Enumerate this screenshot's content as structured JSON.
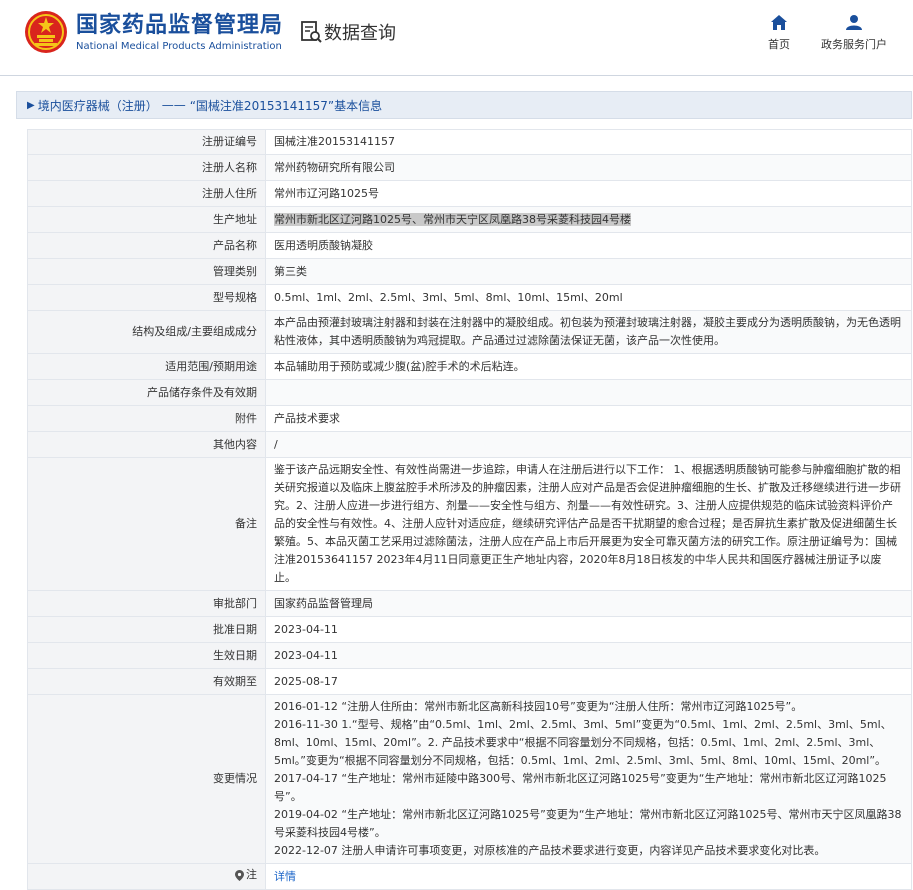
{
  "header": {
    "brand_cn": "国家药品监督管理局",
    "brand_en": "National Medical Products Administration",
    "query_label": "数据查询",
    "nav": {
      "home_label": "首页",
      "portal_label": "政务服务门户"
    }
  },
  "title_bar": {
    "part1": "境内医疗器械（注册）",
    "part2": "——",
    "part3": "“国械注准20153141157”基本信息"
  },
  "rows": {
    "reg_no": {
      "label": "注册证编号",
      "value": "国械注准20153141157"
    },
    "registrant": {
      "label": "注册人名称",
      "value": "常州药物研究所有限公司"
    },
    "registrant_addr": {
      "label": "注册人住所",
      "value": "常州市辽河路1025号"
    },
    "prod_addr": {
      "label": "生产地址",
      "value": "常州市新北区辽河路1025号、常州市天宁区凤凰路38号采菱科技园4号楼"
    },
    "product_name": {
      "label": "产品名称",
      "value": "医用透明质酸钠凝胶"
    },
    "category": {
      "label": "管理类别",
      "value": "第三类"
    },
    "model": {
      "label": "型号规格",
      "value": "0.5ml、1ml、2ml、2.5ml、3ml、5ml、8ml、10ml、15ml、20ml"
    },
    "structure": {
      "label": "结构及组成/主要组成成分",
      "value": "本产品由预灌封玻璃注射器和封装在注射器中的凝胶组成。初包装为预灌封玻璃注射器，凝胶主要成分为透明质酸钠，为无色透明粘性液体，其中透明质酸钠为鸡冠提取。产品通过过滤除菌法保证无菌，该产品一次性使用。"
    },
    "usage": {
      "label": "适用范围/预期用途",
      "value": "本品辅助用于预防或减少腹(盆)腔手术的术后粘连。"
    },
    "storage": {
      "label": "产品储存条件及有效期",
      "value": ""
    },
    "attachment": {
      "label": "附件",
      "value": "产品技术要求"
    },
    "other": {
      "label": "其他内容",
      "value": "/"
    },
    "remarks": {
      "label": "备注",
      "value": "鉴于该产品远期安全性、有效性尚需进一步追踪，申请人在注册后进行以下工作： 1、根据透明质酸钠可能参与肿瘤细胞扩散的相关研究报道以及临床上腹盆腔手术所涉及的肿瘤因素，注册人应对产品是否会促进肿瘤细胞的生长、扩散及迁移继续进行进一步研究。2、注册人应进一步进行组方、剂量——安全性与组方、剂量——有效性研究。3、注册人应提供规范的临床试验资料评价产品的安全性与有效性。4、注册人应针对适应症，继续研究评估产品是否干扰期望的愈合过程；是否屏抗生素扩散及促进细菌生长繁殖。5、本品灭菌工艺采用过滤除菌法，注册人应在产品上市后开展更为安全可靠灭菌方法的研究工作。原注册证编号为：国械注准20153641157 2023年4月11日同意更正生产地址内容，2020年8月18日核发的中华人民共和国医疗器械注册证予以废止。"
    },
    "approval_dept": {
      "label": "审批部门",
      "value": "国家药品监督管理局"
    },
    "approval_date": {
      "label": "批准日期",
      "value": "2023-04-11"
    },
    "effective_date": {
      "label": "生效日期",
      "value": "2023-04-11"
    },
    "expiry": {
      "label": "有效期至",
      "value": "2025-08-17"
    },
    "changes": {
      "label": "变更情况",
      "lines": [
        "2016-01-12 “注册人住所由：常州市新北区高新科技园10号”变更为“注册人住所：常州市辽河路1025号”。",
        "2016-11-30 1.“型号、规格”由“0.5ml、1ml、2ml、2.5ml、3ml、5ml”变更为“0.5ml、1ml、2ml、2.5ml、3ml、5ml、8ml、10ml、15ml、20ml”。2. 产品技术要求中“根据不同容量划分不同规格，包括：0.5ml、1ml、2ml、2.5ml、3ml、5ml。”变更为“根据不同容量划分不同规格，包括：0.5ml、1ml、2ml、2.5ml、3ml、5ml、8ml、10ml、15ml、20ml”。",
        "2017-04-17 “生产地址：常州市延陵中路300号、常州市新北区辽河路1025号”变更为“生产地址：常州市新北区辽河路1025号”。",
        "2019-04-02 “生产地址：常州市新北区辽河路1025号”变更为“生产地址：常州市新北区辽河路1025号、常州市天宁区凤凰路38号采菱科技园4号楼”。",
        "2022-12-07 注册人申请许可事项变更，对原核准的产品技术要求进行变更，内容详见产品技术要求变化对比表。"
      ]
    },
    "note": {
      "label": "注",
      "value": "详情",
      "icon": "pin-icon"
    }
  }
}
